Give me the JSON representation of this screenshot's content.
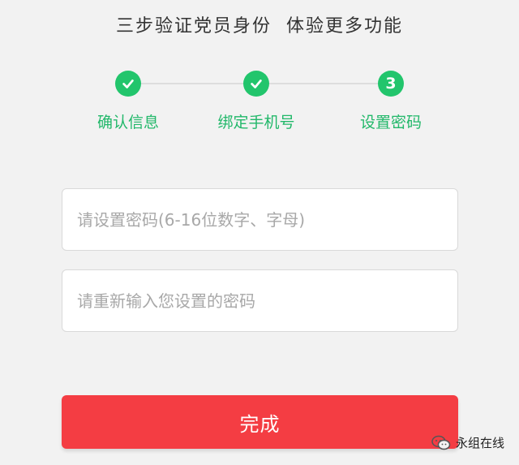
{
  "header": {
    "title": "三步验证党员身份  体验更多功能"
  },
  "steps": [
    {
      "label": "确认信息",
      "state": "done"
    },
    {
      "label": "绑定手机号",
      "state": "done"
    },
    {
      "label": "设置密码",
      "state": "current",
      "number": "3"
    }
  ],
  "form": {
    "password_placeholder": "请设置密码(6-16位数字、字母)",
    "password_value": "",
    "confirm_placeholder": "请重新输入您设置的密码",
    "confirm_value": ""
  },
  "submit_label": "完成",
  "watermark": {
    "text": "永组在线"
  },
  "colors": {
    "accent_green": "#22c56c",
    "button_red": "#f43d43",
    "background": "#f2f2f2"
  }
}
